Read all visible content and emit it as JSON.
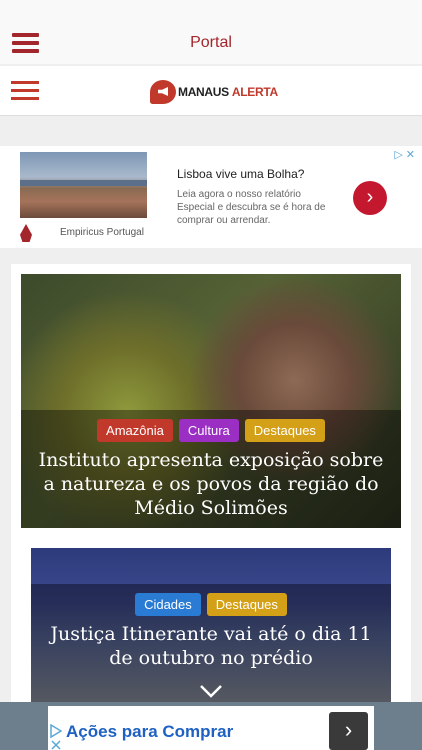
{
  "header": {
    "title": "Portal"
  },
  "site": {
    "logo_left": "MANAUS",
    "logo_right": "ALERTA"
  },
  "ad": {
    "title": "Lisboa vive uma Bolha?",
    "text": "Leia agora o nosso relatório Especial e descubra se é hora de comprar ou arrendar.",
    "brand": "Empiricus Portugal"
  },
  "articles": [
    {
      "tags": [
        {
          "label": "Amazônia",
          "color": "#c0392b"
        },
        {
          "label": "Cultura",
          "color": "#9b2fc4"
        },
        {
          "label": "Destaques",
          "color": "#d4a017"
        }
      ],
      "headline": "Instituto apresenta exposição sobre a natureza e os povos da região do Médio Solimões"
    },
    {
      "tags": [
        {
          "label": "Cidades",
          "color": "#2a7bd4"
        },
        {
          "label": "Destaques",
          "color": "#d4a017"
        }
      ],
      "headline": "Justiça Itinerante vai até o dia 11 de outubro no prédio"
    }
  ],
  "bottom_ad": {
    "title": "Ações para Comprar"
  },
  "colors": {
    "brand": "#a3262c",
    "accent": "#c0392b"
  }
}
